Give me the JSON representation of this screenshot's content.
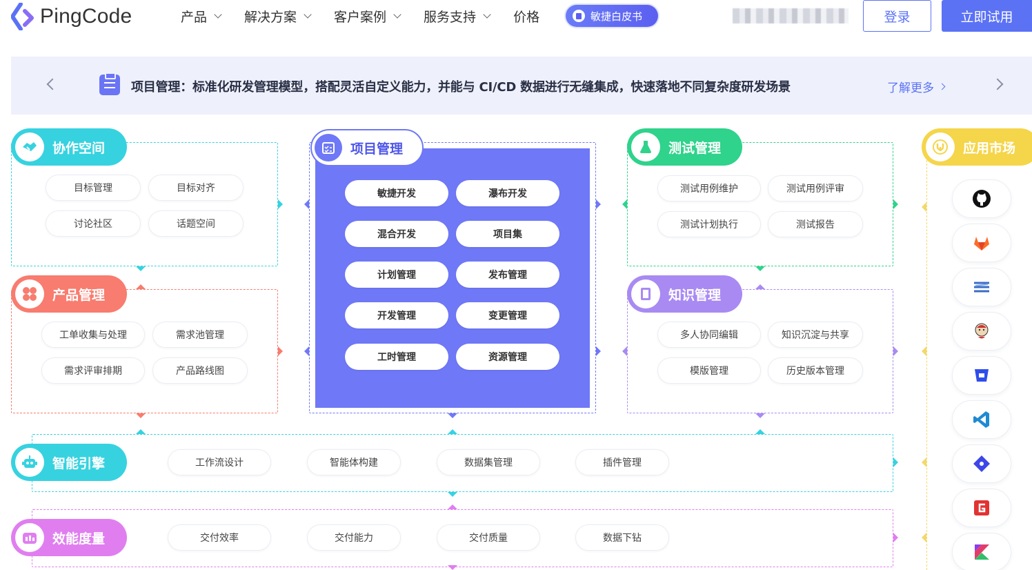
{
  "header": {
    "logo_text": "PingCode",
    "nav": [
      {
        "label": "产品"
      },
      {
        "label": "解决方案"
      },
      {
        "label": "客户案例"
      },
      {
        "label": "服务支持"
      },
      {
        "label": "价格"
      }
    ],
    "badge_label": "敏捷白皮书",
    "login_label": "登录",
    "try_label": "立即试用"
  },
  "banner": {
    "text": "项目管理：标准化研发管理模型，搭配灵活自定义能力，并能与 CI/CD 数据进行无缝集成，快速落地不同复杂度研发场景",
    "more_label": "了解更多"
  },
  "modules": {
    "collab": {
      "title": "协作空间",
      "color": "#37d2e0",
      "items": [
        "目标管理",
        "目标对齐",
        "讨论社区",
        "话题空间"
      ]
    },
    "product": {
      "title": "产品管理",
      "color": "#f87c6f",
      "items": [
        "工单收集与处理",
        "需求池管理",
        "需求评审排期",
        "产品路线图"
      ]
    },
    "project": {
      "title": "项目管理",
      "color": "#6f78f6",
      "items": [
        "敏捷开发",
        "瀑布开发",
        "混合开发",
        "项目集",
        "计划管理",
        "发布管理",
        "开发管理",
        "变更管理",
        "工时管理",
        "资源管理"
      ]
    },
    "testing": {
      "title": "测试管理",
      "color": "#2fd38b",
      "items": [
        "测试用例维护",
        "测试用例评审",
        "测试计划执行",
        "测试报告"
      ]
    },
    "knowledge": {
      "title": "知识管理",
      "color": "#a98af2",
      "items": [
        "多人协同编辑",
        "知识沉淀与共享",
        "模版管理",
        "历史版本管理"
      ]
    },
    "ai": {
      "title": "智能引擎",
      "color": "#37d2e0",
      "items": [
        "工作流设计",
        "智能体构建",
        "数据集管理",
        "插件管理"
      ]
    },
    "metrics": {
      "title": "效能度量",
      "color": "#e07ef0",
      "items": [
        "交付效率",
        "交付能力",
        "交付质量",
        "数据下钻"
      ]
    },
    "market": {
      "title": "应用市场",
      "color": "#f5d54a"
    }
  },
  "apps": [
    "github-icon",
    "gitlab-icon",
    "layers-icon",
    "jenkins-icon",
    "bitbucket-icon",
    "vscode-icon",
    "git-icon",
    "gitee-icon",
    "kotlin-icon"
  ]
}
